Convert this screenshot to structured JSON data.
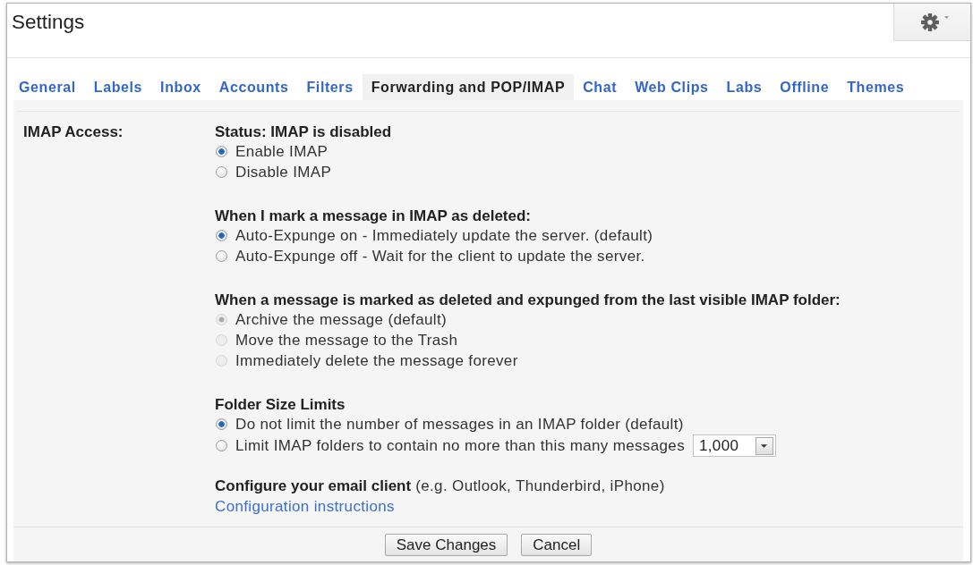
{
  "window": {
    "title": "Settings"
  },
  "tabs": [
    {
      "label": "General",
      "selected": false
    },
    {
      "label": "Labels",
      "selected": false
    },
    {
      "label": "Inbox",
      "selected": false
    },
    {
      "label": "Accounts",
      "selected": false
    },
    {
      "label": "Filters",
      "selected": false
    },
    {
      "label": "Forwarding and POP/IMAP",
      "selected": true
    },
    {
      "label": "Chat",
      "selected": false
    },
    {
      "label": "Web Clips",
      "selected": false
    },
    {
      "label": "Labs",
      "selected": false
    },
    {
      "label": "Offline",
      "selected": false
    },
    {
      "label": "Themes",
      "selected": false
    }
  ],
  "settings": [
    {
      "label": "IMAP Access:",
      "sections": [
        {
          "kind": "radios",
          "heading": "Status: IMAP is disabled",
          "options": [
            {
              "label": "Enable IMAP",
              "selected": true,
              "disabled": false
            },
            {
              "label": "Disable IMAP",
              "selected": false,
              "disabled": false
            }
          ]
        },
        {
          "kind": "radios",
          "heading": "When I mark a message in IMAP as deleted:",
          "options": [
            {
              "label": "Auto-Expunge on - Immediately update the server. (default)",
              "selected": true,
              "disabled": false
            },
            {
              "label": "Auto-Expunge off - Wait for the client to update the server.",
              "selected": false,
              "disabled": false
            }
          ]
        },
        {
          "kind": "radios",
          "heading": "When a message is marked as deleted and expunged from the last visible IMAP folder:",
          "options": [
            {
              "label": "Archive the message (default)",
              "selected": true,
              "disabled": true
            },
            {
              "label": "Move the message to the Trash",
              "selected": false,
              "disabled": true
            },
            {
              "label": "Immediately delete the message forever",
              "selected": false,
              "disabled": true
            }
          ]
        },
        {
          "kind": "radios",
          "heading": "Folder Size Limits",
          "options": [
            {
              "label": "Do not limit the number of messages in an IMAP folder (default)",
              "selected": true,
              "disabled": false
            },
            {
              "label": "Limit IMAP folders to contain no more than this many messages",
              "selected": false,
              "disabled": false,
              "dropdown": {
                "value": "1,000"
              }
            }
          ]
        },
        {
          "kind": "info",
          "text": "**Configure your email client** (e.g. Outlook, Thunderbird, iPhone)",
          "link": "Configuration instructions"
        }
      ]
    }
  ],
  "buttons": [
    {
      "label": "Save Changes"
    },
    {
      "label": "Cancel"
    }
  ]
}
